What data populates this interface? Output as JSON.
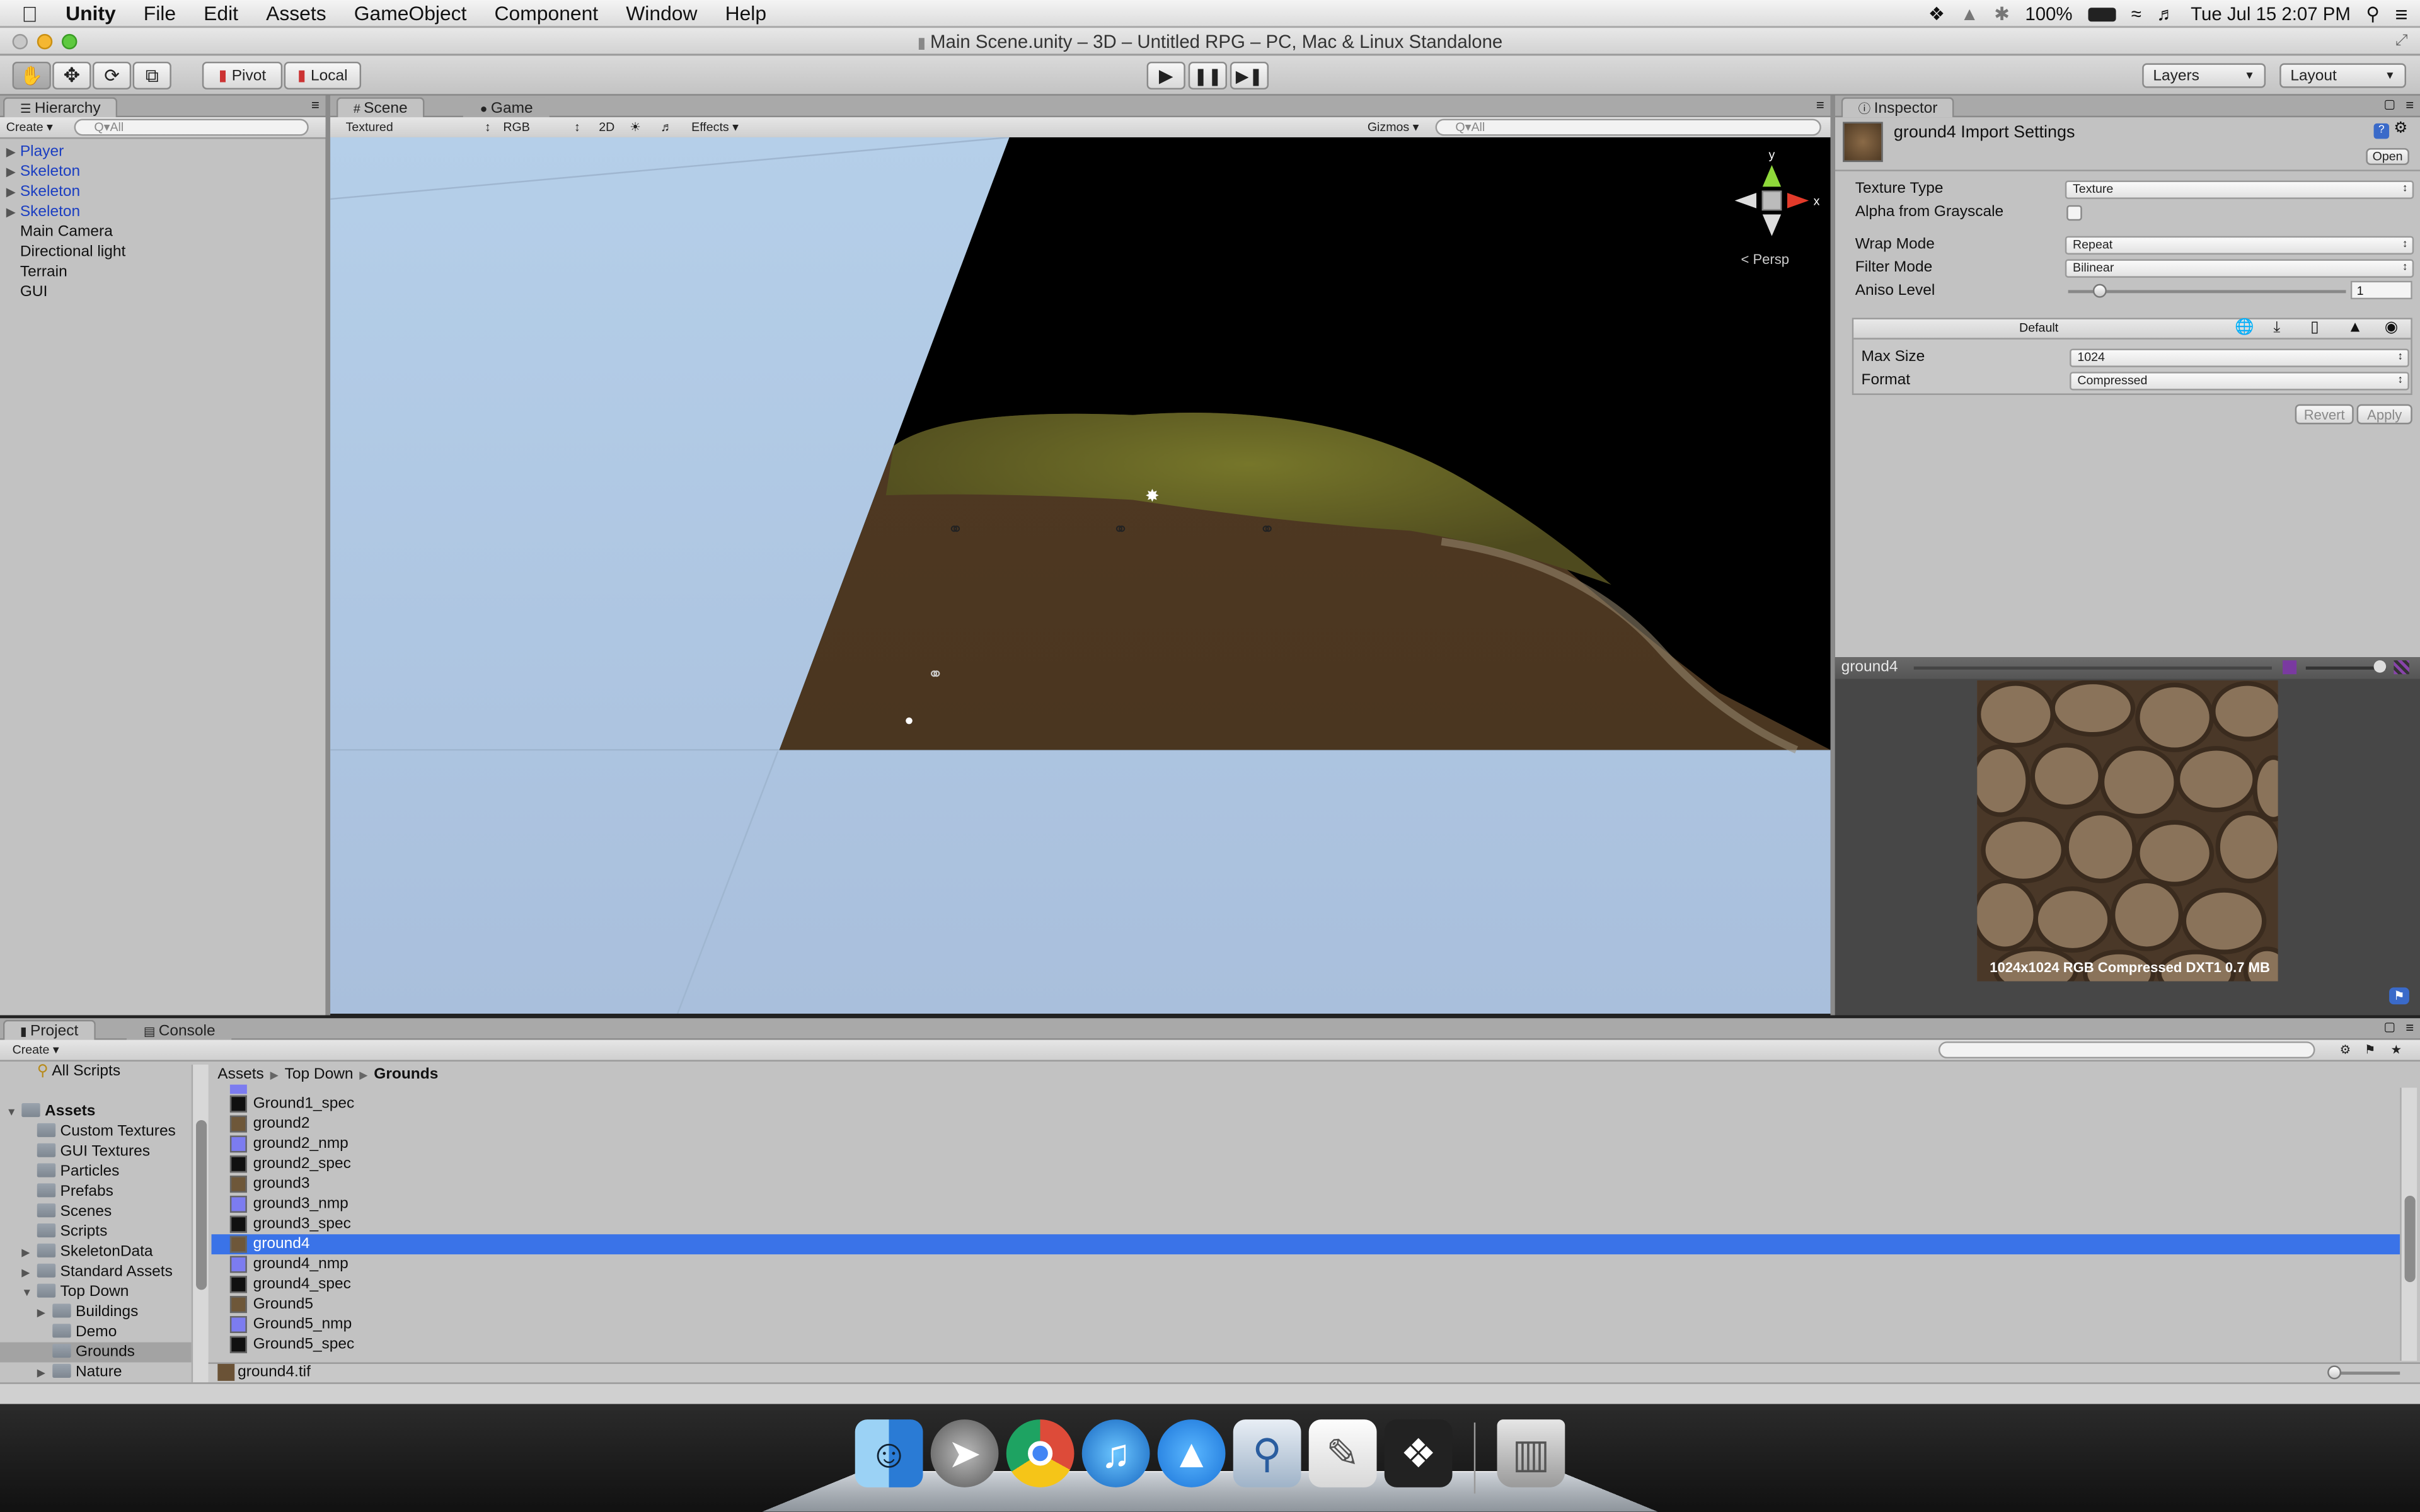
{
  "menubar": {
    "app_name": "Unity",
    "items": [
      "File",
      "Edit",
      "Assets",
      "GameObject",
      "Component",
      "Window",
      "Help"
    ],
    "battery": "100%",
    "clock": "Tue Jul 15  2:07 PM"
  },
  "window": {
    "title": "Main Scene.unity – 3D – Untitled RPG – PC, Mac & Linux Standalone"
  },
  "toolbar": {
    "pivot_label": "Pivot",
    "local_label": "Local",
    "layers_label": "Layers",
    "layout_label": "Layout"
  },
  "hierarchy": {
    "tab_label": "Hierarchy",
    "create_label": "Create",
    "search_placeholder": "Q▾All",
    "items": [
      {
        "label": "Player",
        "expandable": true
      },
      {
        "label": "Skeleton",
        "expandable": true
      },
      {
        "label": "Skeleton",
        "expandable": true
      },
      {
        "label": "Skeleton",
        "expandable": true
      },
      {
        "label": "Main Camera",
        "expandable": false
      },
      {
        "label": "Directional light",
        "expandable": false
      },
      {
        "label": "Terrain",
        "expandable": false
      },
      {
        "label": "GUI",
        "expandable": false
      }
    ]
  },
  "scene_view": {
    "tabs": [
      "Scene",
      "Game"
    ],
    "render_mode": "Textured",
    "color_mode": "RGB",
    "mode_2d": "2D",
    "effects_label": "Effects",
    "gizmos_label": "Gizmos",
    "search_placeholder": "Q▾All",
    "gizmo_y": "y",
    "gizmo_x": "x",
    "persp_label": "< Persp"
  },
  "inspector": {
    "tab_label": "Inspector",
    "asset_title": "ground4 Import Settings",
    "open_label": "Open",
    "fields": {
      "texture_type": {
        "label": "Texture Type",
        "value": "Texture"
      },
      "alpha_from_grayscale": {
        "label": "Alpha from Grayscale",
        "checked": false
      },
      "wrap_mode": {
        "label": "Wrap Mode",
        "value": "Repeat"
      },
      "filter_mode": {
        "label": "Filter Mode",
        "value": "Bilinear"
      },
      "aniso_level": {
        "label": "Aniso Level",
        "value": "1",
        "fraction": 0.12
      }
    },
    "platform_tab": "Default",
    "max_size": {
      "label": "Max Size",
      "value": "1024"
    },
    "format": {
      "label": "Format",
      "value": "Compressed"
    },
    "revert_label": "Revert",
    "apply_label": "Apply"
  },
  "preview": {
    "name": "ground4",
    "info": "1024x1024  RGB Compressed DXT1   0.7 MB",
    "mip_fraction": 0.85
  },
  "project": {
    "tabs": [
      "Project",
      "Console"
    ],
    "create_label": "Create",
    "favorites_item": "All Scripts",
    "tree": [
      {
        "label": "Assets",
        "depth": 0,
        "open": true,
        "bold": true
      },
      {
        "label": "Custom Textures",
        "depth": 1
      },
      {
        "label": "GUI Textures",
        "depth": 1
      },
      {
        "label": "Particles",
        "depth": 1
      },
      {
        "label": "Prefabs",
        "depth": 1
      },
      {
        "label": "Scenes",
        "depth": 1
      },
      {
        "label": "Scripts",
        "depth": 1
      },
      {
        "label": "SkeletonData",
        "depth": 1,
        "collapsed": true
      },
      {
        "label": "Standard Assets",
        "depth": 1,
        "collapsed": true
      },
      {
        "label": "Top Down",
        "depth": 1,
        "open": true
      },
      {
        "label": "Buildings",
        "depth": 2,
        "collapsed": true
      },
      {
        "label": "Demo",
        "depth": 2
      },
      {
        "label": "Grounds",
        "depth": 2,
        "selected": true
      },
      {
        "label": "Nature",
        "depth": 2,
        "collapsed": true
      }
    ],
    "breadcrumb": [
      "Assets",
      "Top Down",
      "Grounds"
    ],
    "files": [
      {
        "name": "Ground1_spec",
        "kind": "spec"
      },
      {
        "name": "ground2",
        "kind": "tex"
      },
      {
        "name": "ground2_nmp",
        "kind": "nmp"
      },
      {
        "name": "ground2_spec",
        "kind": "spec"
      },
      {
        "name": "ground3",
        "kind": "tex"
      },
      {
        "name": "ground3_nmp",
        "kind": "nmp"
      },
      {
        "name": "ground3_spec",
        "kind": "spec"
      },
      {
        "name": "ground4",
        "kind": "tex",
        "selected": true
      },
      {
        "name": "ground4_nmp",
        "kind": "nmp"
      },
      {
        "name": "ground4_spec",
        "kind": "spec"
      },
      {
        "name": "Ground5",
        "kind": "tex"
      },
      {
        "name": "Ground5_nmp",
        "kind": "nmp"
      },
      {
        "name": "Ground5_spec",
        "kind": "spec"
      }
    ],
    "selected_file_path": "ground4.tif"
  },
  "dock": {
    "apps": [
      "Finder",
      "Launchpad",
      "Chrome",
      "iTunes",
      "App Store",
      "Preview",
      "TextEdit",
      "Unity",
      "Trash"
    ]
  },
  "colors": {
    "selection_blue": "#3a73e8",
    "hierarchy_prefab_blue": "#1b3ec1",
    "panel_grey": "#c2c2c2",
    "sky": "#aac6e6",
    "terrain_brown": "#4e3a22",
    "terrain_grass": "#6b6a22"
  }
}
